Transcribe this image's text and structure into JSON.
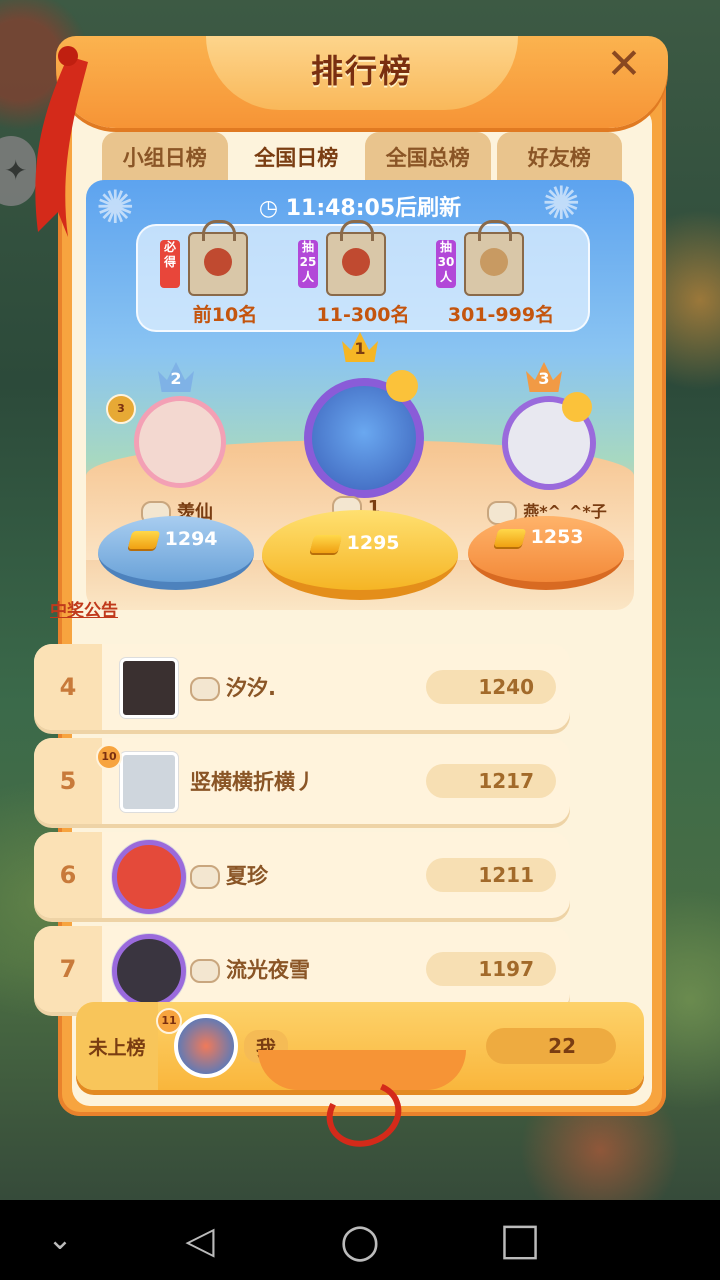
{
  "title": "排行榜",
  "close_icon": "close-icon",
  "tabs": [
    {
      "label": "小组日榜",
      "active": false
    },
    {
      "label": "全国日榜",
      "active": true
    },
    {
      "label": "全国总榜",
      "active": false
    },
    {
      "label": "好友榜",
      "active": false
    }
  ],
  "timer": {
    "time": "11:48:05",
    "suffix": "后刷新"
  },
  "prizes": [
    {
      "tag": "必得",
      "label": "前10名",
      "color": "#e8463a"
    },
    {
      "tag": "抽25人",
      "label": "11-300名",
      "color": "#b248d8"
    },
    {
      "tag": "抽30人",
      "label": "301-999名",
      "color": "#b248d8"
    }
  ],
  "podium": {
    "first": {
      "rank": "1",
      "name": "1",
      "score": "1295"
    },
    "second": {
      "rank": "2",
      "level": "3",
      "name": "羡仙",
      "score": "1294"
    },
    "third": {
      "rank": "3",
      "name": "燕*^_^*子",
      "score": "1253"
    }
  },
  "notice": "中奖公告",
  "rows": [
    {
      "rank": "4",
      "name": "汐汐.",
      "score": "1240",
      "badge": "",
      "rabbit": true
    },
    {
      "rank": "5",
      "name": "竖横横折横丿",
      "score": "1217",
      "badge": "10",
      "rabbit": false
    },
    {
      "rank": "6",
      "name": "夏珍",
      "score": "1211",
      "badge": "",
      "rabbit": true
    },
    {
      "rank": "7",
      "name": "流光夜雪",
      "score": "1197",
      "badge": "",
      "rabbit": true
    }
  ],
  "me": {
    "rank": "未上榜",
    "badge": "11",
    "name": "我",
    "score": "22"
  },
  "nav": {
    "down": "⌄",
    "back": "◁",
    "home": "○",
    "recent": "□"
  }
}
